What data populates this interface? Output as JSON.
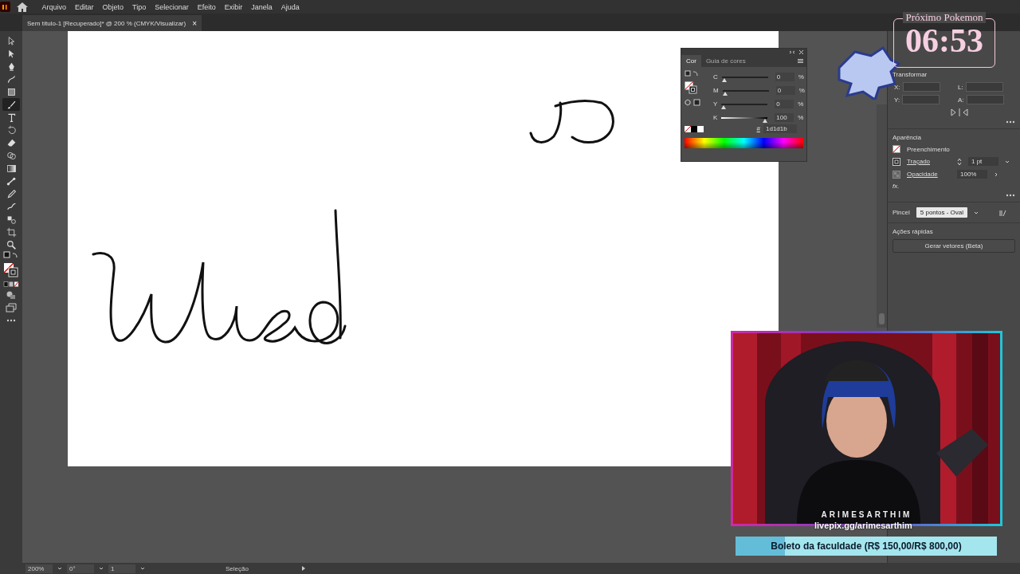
{
  "menu_bar": {
    "items": [
      "Arquivo",
      "Editar",
      "Objeto",
      "Tipo",
      "Selecionar",
      "Efeito",
      "Exibir",
      "Janela",
      "Ajuda"
    ]
  },
  "document_tab": {
    "title": "Sem título-1 [Recuperado]* @ 200 % (CMYK/Visualizar)",
    "close": "×"
  },
  "tools": [
    {
      "kind": "direct-select",
      "selected": false
    },
    {
      "kind": "select",
      "selected": false
    },
    {
      "kind": "pen",
      "selected": false
    },
    {
      "kind": "curvature",
      "selected": false
    },
    {
      "kind": "rectangle",
      "selected": false
    },
    {
      "kind": "brush",
      "selected": true
    },
    {
      "kind": "type",
      "selected": false
    },
    {
      "kind": "rotate",
      "selected": false
    },
    {
      "kind": "eraser",
      "selected": false
    },
    {
      "kind": "shape-builder",
      "selected": false
    },
    {
      "kind": "gradient",
      "selected": false
    },
    {
      "kind": "blend",
      "selected": false
    },
    {
      "kind": "eyedropper",
      "selected": false
    },
    {
      "kind": "puppet",
      "selected": false
    },
    {
      "kind": "symbol",
      "selected": false
    },
    {
      "kind": "artboard",
      "selected": false
    },
    {
      "kind": "zoom",
      "selected": false
    }
  ],
  "color_panel": {
    "tabs": [
      {
        "label": "Cor",
        "selected": true
      },
      {
        "label": "Guia de cores",
        "selected": false
      }
    ],
    "channels": [
      {
        "name": "C",
        "value": "0",
        "unit": "%",
        "level": 0
      },
      {
        "name": "M",
        "value": "0",
        "unit": "%",
        "level": 0
      },
      {
        "name": "Y",
        "value": "0",
        "unit": "%",
        "level": 0
      },
      {
        "name": "K",
        "value": "100",
        "unit": "%",
        "level": 1
      }
    ],
    "hex_label": "#",
    "hex": "1d1d1b"
  },
  "properties_panel": {
    "transform_title": "Transformar",
    "transform_labels": [
      "X:",
      "L:",
      "Y:",
      "A:"
    ],
    "appearance_title": "Aparência",
    "appearance_rows": [
      {
        "kind": "fill",
        "label": "Preenchimento"
      },
      {
        "kind": "stroke",
        "label": "Traçado",
        "value": "1 pt"
      },
      {
        "kind": "opacity",
        "label": "Opacidade",
        "value": "100%"
      }
    ],
    "fx": "fx.",
    "brush_label": "Pincel",
    "brush_value": "5 pontos - Oval",
    "quick_actions_title": "Ações rápidas",
    "quick_action_button": "Gerar vetores (Beta)"
  },
  "status_bar": {
    "zoom": "200%",
    "rotation": "0°",
    "artboard": "1",
    "tool": "Seleção"
  },
  "stream_overlay": {
    "timer_title": "Próximo Pokemon",
    "timer": "06:53",
    "channel_name": "ARIMESARTHIM",
    "link": "livepix.gg/arimesarthim",
    "goal": {
      "label": "Boleto da faculdade (R$ 150,00/R$ 800,00)",
      "level": 0.1875
    }
  }
}
